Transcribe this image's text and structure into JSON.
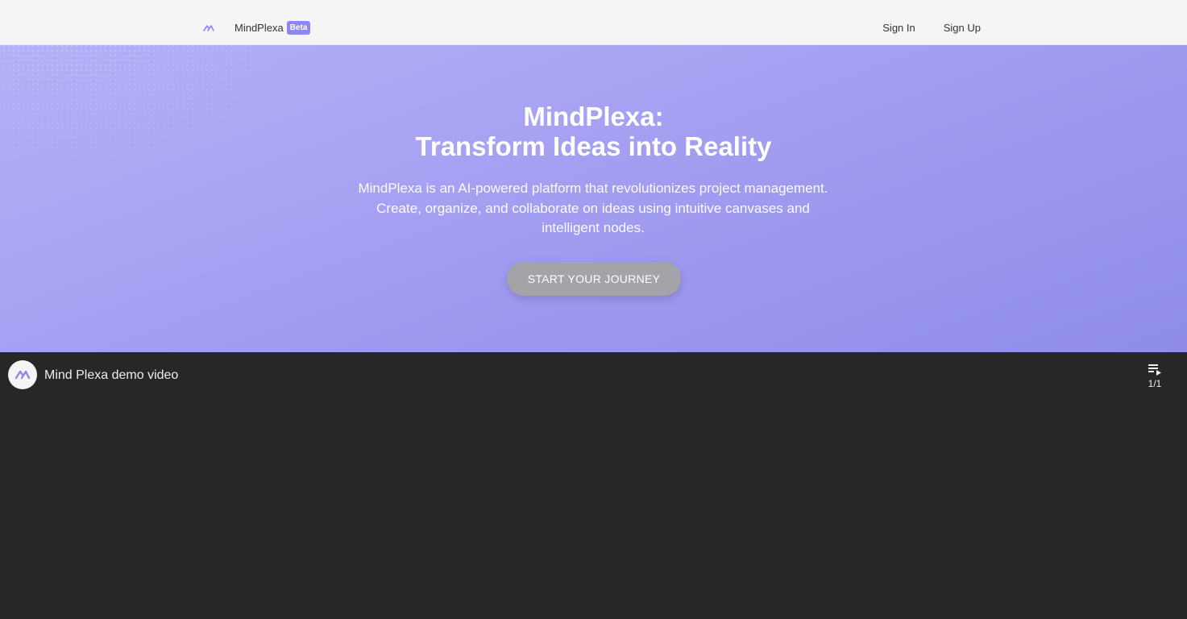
{
  "navbar": {
    "brand_name": "MindPlexa",
    "beta_label": "Beta",
    "sign_in": "Sign In",
    "sign_up": "Sign Up"
  },
  "hero": {
    "title_line1": "MindPlexa:",
    "title_line2": "Transform Ideas into Reality",
    "description": "MindPlexa is an AI-powered platform that revolutionizes project management. Create, organize, and collaborate on ideas using intuitive canvases and intelligent nodes.",
    "cta_label": "START YOUR JOURNEY"
  },
  "video": {
    "title": "Mind Plexa demo video",
    "playlist_count": "1/1",
    "playlist_icon": "playlist-icon",
    "channel_icon": "mindplexa-logo-icon"
  },
  "colors": {
    "accent": "#8f87f1",
    "hero_gradient_start": "#b5b1f7",
    "hero_gradient_end": "#8f8ce8",
    "video_background": "#272727"
  }
}
